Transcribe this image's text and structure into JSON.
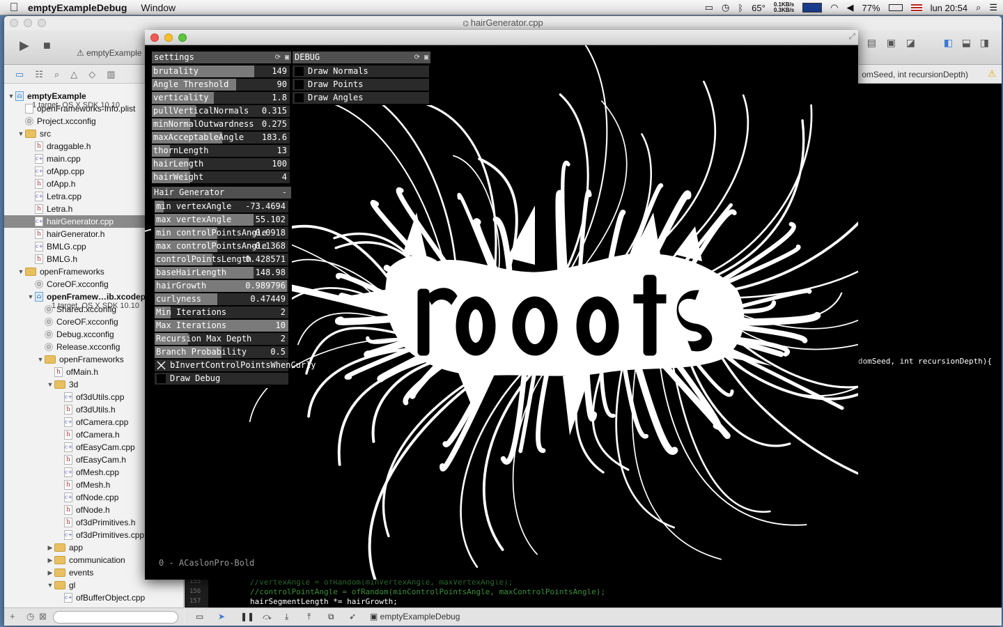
{
  "menubar": {
    "app_name": "emptyExampleDebug",
    "menu_window": "Window",
    "temp": "65°",
    "net_up": "0.1KB/s",
    "net_down": "0.3KB/s",
    "battery": "77%",
    "clock": "lun 20:54"
  },
  "xcode": {
    "title": "hairGenerator.cpp",
    "scheme": "emptyExample",
    "jump_text": "omSeed, int recursionDepth)",
    "status_target": "emptyExampleDebug",
    "code_signature": "domSeed, int recursionDepth){",
    "code_lines": [
      {
        "no": "155",
        "text": "//vertexAngle = ofRandom(minVertexAngle, maxVertexAngle);"
      },
      {
        "no": "156",
        "text": "//controlPointAngle = ofRandom(minControlPointsAngle, maxControlPointsAngle);"
      },
      {
        "no": "157",
        "text": "hairSegmentLength *= hairGrowth;"
      }
    ]
  },
  "navigator": {
    "items": [
      {
        "label": "emptyExample",
        "sub": "1 target, OS X SDK 10.10",
        "kind": "proj",
        "depth": 0,
        "open": true
      },
      {
        "label": "openFrameworks-Info.plist",
        "kind": "file",
        "depth": 1
      },
      {
        "label": "Project.xcconfig",
        "kind": "cfg",
        "depth": 1
      },
      {
        "label": "src",
        "kind": "folder",
        "depth": 1,
        "open": true
      },
      {
        "label": "draggable.h",
        "kind": "h",
        "depth": 2
      },
      {
        "label": "main.cpp",
        "kind": "cpp",
        "depth": 2
      },
      {
        "label": "ofApp.cpp",
        "kind": "cpp",
        "depth": 2
      },
      {
        "label": "ofApp.h",
        "kind": "h",
        "depth": 2
      },
      {
        "label": "Letra.cpp",
        "kind": "cpp",
        "depth": 2
      },
      {
        "label": "Letra.h",
        "kind": "h",
        "depth": 2
      },
      {
        "label": "hairGenerator.cpp",
        "kind": "cpp",
        "depth": 2,
        "selected": true
      },
      {
        "label": "hairGenerator.h",
        "kind": "h",
        "depth": 2
      },
      {
        "label": "BMLG.cpp",
        "kind": "cpp",
        "depth": 2
      },
      {
        "label": "BMLG.h",
        "kind": "h",
        "depth": 2
      },
      {
        "label": "openFrameworks",
        "kind": "folder",
        "depth": 1,
        "open": true
      },
      {
        "label": "CoreOF.xcconfig",
        "kind": "cfg",
        "depth": 2
      },
      {
        "label": "openFramew…ib.xcodeproj",
        "sub": "1 target, OS X SDK 10.10",
        "kind": "proj",
        "depth": 2,
        "open": true
      },
      {
        "label": "Shared.xcconfig",
        "kind": "cfg",
        "depth": 3
      },
      {
        "label": "CoreOF.xcconfig",
        "kind": "cfg",
        "depth": 3
      },
      {
        "label": "Debug.xcconfig",
        "kind": "cfg",
        "depth": 3
      },
      {
        "label": "Release.xcconfig",
        "kind": "cfg",
        "depth": 3
      },
      {
        "label": "openFrameworks",
        "kind": "folder",
        "depth": 3,
        "open": true
      },
      {
        "label": "ofMain.h",
        "kind": "h",
        "depth": 4
      },
      {
        "label": "3d",
        "kind": "folder",
        "depth": 4,
        "open": true
      },
      {
        "label": "of3dUtils.cpp",
        "kind": "cpp",
        "depth": 5
      },
      {
        "label": "of3dUtils.h",
        "kind": "h",
        "depth": 5
      },
      {
        "label": "ofCamera.cpp",
        "kind": "cpp",
        "depth": 5
      },
      {
        "label": "ofCamera.h",
        "kind": "h",
        "depth": 5
      },
      {
        "label": "ofEasyCam.cpp",
        "kind": "cpp",
        "depth": 5
      },
      {
        "label": "ofEasyCam.h",
        "kind": "h",
        "depth": 5
      },
      {
        "label": "ofMesh.cpp",
        "kind": "cpp",
        "depth": 5
      },
      {
        "label": "ofMesh.h",
        "kind": "h",
        "depth": 5
      },
      {
        "label": "ofNode.cpp",
        "kind": "cpp",
        "depth": 5
      },
      {
        "label": "ofNode.h",
        "kind": "h",
        "depth": 5
      },
      {
        "label": "of3dPrimitives.h",
        "kind": "h",
        "depth": 5
      },
      {
        "label": "of3dPrimitives.cpp",
        "kind": "cpp",
        "depth": 5
      },
      {
        "label": "app",
        "kind": "folder",
        "depth": 4,
        "open": false
      },
      {
        "label": "communication",
        "kind": "folder",
        "depth": 4,
        "open": false
      },
      {
        "label": "events",
        "kind": "folder",
        "depth": 4,
        "open": false
      },
      {
        "label": "gl",
        "kind": "folder",
        "depth": 4,
        "open": true
      },
      {
        "label": "ofBufferObject.cpp",
        "kind": "cpp",
        "depth": 5
      }
    ]
  },
  "settings": {
    "title": "settings",
    "sliders": [
      {
        "label": "brutality",
        "value": "149",
        "fill": 0.74
      },
      {
        "label": "Angle Threshold",
        "value": "90",
        "fill": 0.61
      },
      {
        "label": "verticality",
        "value": "1.8",
        "fill": 0.45
      },
      {
        "label": "pullVerticalNormals",
        "value": "0.315",
        "fill": 0.32
      },
      {
        "label": "minNormalOutwardness",
        "value": "0.275",
        "fill": 0.28
      },
      {
        "label": "maxAcceptableAngle",
        "value": "183.6",
        "fill": 0.51
      },
      {
        "label": "thornLength",
        "value": "13",
        "fill": 0.13
      },
      {
        "label": "hairLength",
        "value": "100",
        "fill": 0.27
      },
      {
        "label": "hairWeight",
        "value": "4",
        "fill": 0.28
      }
    ]
  },
  "hair_generator": {
    "title": "Hair Generator",
    "collapse": "-",
    "sliders": [
      {
        "label": "min vertexAngle",
        "value": "-73.4694",
        "fill": 0.07
      },
      {
        "label": "max vertexAngle",
        "value": "55.102",
        "fill": 0.74
      },
      {
        "label": "min controlPointsAngle",
        "value": "-0.0918",
        "fill": 0.47
      },
      {
        "label": "max controlPointsAngle",
        "value": "-0.1368",
        "fill": 0.47
      },
      {
        "label": "controlPointsLength",
        "value": "0.428571",
        "fill": 0.43
      },
      {
        "label": "baseHairLength",
        "value": "148.98",
        "fill": 0.74
      },
      {
        "label": "hairGrowth",
        "value": "0.989796",
        "fill": 0.99
      },
      {
        "label": "curlyness",
        "value": "0.47449",
        "fill": 0.47
      },
      {
        "label": "Min Iterations",
        "value": "2",
        "fill": 0.12
      },
      {
        "label": "Max Iterations",
        "value": "10",
        "fill": 1.0
      },
      {
        "label": "Recursion Max Depth",
        "value": "2",
        "fill": 0.25
      },
      {
        "label": "Branch Probability",
        "value": "0.5",
        "fill": 0.5
      }
    ],
    "toggles": [
      {
        "label": "bInvertControlPointsWhenCurly",
        "checked": true
      },
      {
        "label": "Draw Debug",
        "checked": false
      }
    ]
  },
  "debug": {
    "title": "DEBUG",
    "toggles": [
      {
        "label": "Draw Normals",
        "checked": false
      },
      {
        "label": "Draw Points",
        "checked": false
      },
      {
        "label": "Draw Angles",
        "checked": false
      }
    ]
  },
  "canvas": {
    "font_label": "0 - ACaslonPro-Bold",
    "word": "roots"
  }
}
